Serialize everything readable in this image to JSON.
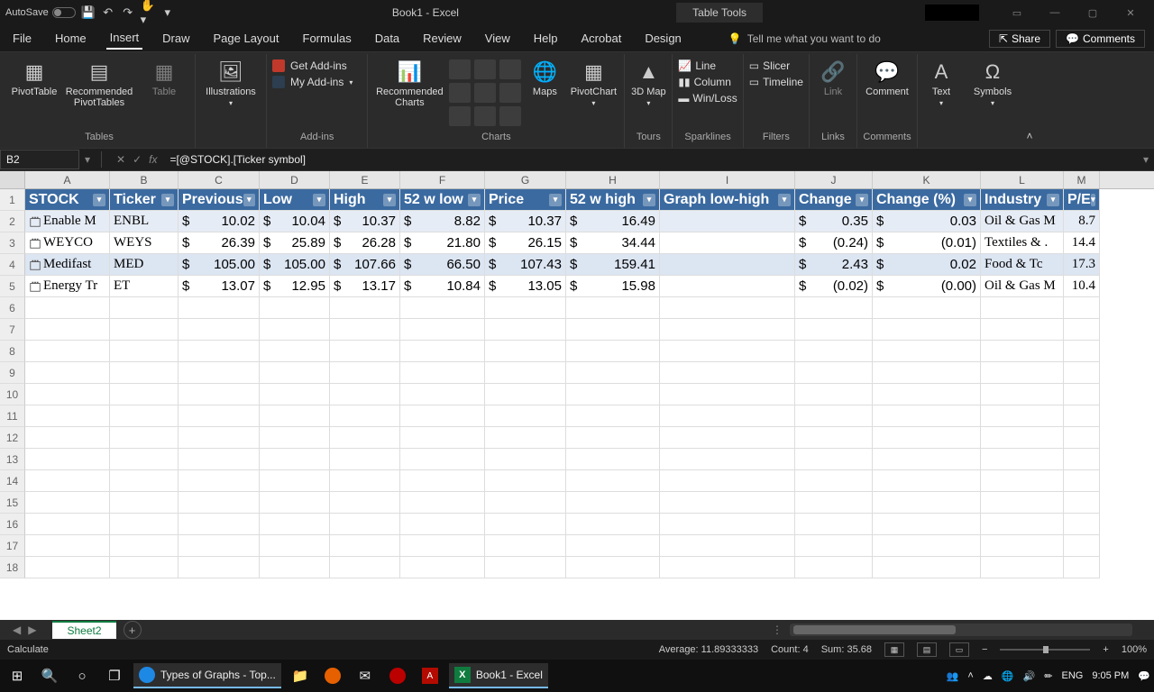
{
  "title": "Book1 - Excel",
  "autosave_label": "AutoSave",
  "table_tools": "Table Tools",
  "tabs": {
    "file": "File",
    "home": "Home",
    "insert": "Insert",
    "draw": "Draw",
    "page_layout": "Page Layout",
    "formulas": "Formulas",
    "data": "Data",
    "review": "Review",
    "view": "View",
    "help": "Help",
    "acrobat": "Acrobat",
    "design": "Design"
  },
  "tellme": "Tell me what you want to do",
  "share": "Share",
  "comments_btn": "Comments",
  "ribbon": {
    "tables": {
      "pivottable": "PivotTable",
      "recommended_pt": "Recommended PivotTables",
      "table": "Table",
      "label": "Tables"
    },
    "illustrations": {
      "btn": "Illustrations"
    },
    "addins": {
      "get": "Get Add-ins",
      "my": "My Add-ins",
      "label": "Add-ins"
    },
    "charts": {
      "recommended": "Recommended Charts",
      "maps": "Maps",
      "pivotchart": "PivotChart",
      "label": "Charts"
    },
    "tours": {
      "map": "3D Map",
      "label": "Tours"
    },
    "sparklines": {
      "line": "Line",
      "col": "Column",
      "winloss": "Win/Loss",
      "label": "Sparklines"
    },
    "filters": {
      "slicer": "Slicer",
      "timeline": "Timeline",
      "label": "Filters"
    },
    "links": {
      "link": "Link",
      "label": "Links"
    },
    "comments": {
      "comment": "Comment",
      "label": "Comments"
    },
    "text": {
      "text": "Text"
    },
    "symbols": {
      "symbols": "Symbols"
    }
  },
  "namebox": "B2",
  "formula": "=[@STOCK].[Ticker symbol]",
  "columns": [
    "A",
    "B",
    "C",
    "D",
    "E",
    "F",
    "G",
    "H",
    "I",
    "J",
    "K",
    "L",
    "M"
  ],
  "headers": {
    "stock": "STOCK",
    "ticker": "Ticker",
    "previous": "Previous",
    "low": "Low",
    "high": "High",
    "w52low": "52 w low",
    "price": "Price",
    "w52high": "52 w high",
    "graph": "Graph low-high",
    "change": "Change",
    "changepct": "Change (%)",
    "industry": "Industry",
    "pe": "P/E"
  },
  "rows": [
    {
      "stock": "Enable M",
      "ticker": "ENBL",
      "previous": "10.02",
      "low": "10.04",
      "high": "10.37",
      "w52low": "8.82",
      "price": "10.37",
      "w52high": "16.49",
      "change": "0.35",
      "changepct": "0.03",
      "industry": "Oil & Gas M",
      "pe": "8.7"
    },
    {
      "stock": "WEYCO",
      "ticker": "WEYS",
      "previous": "26.39",
      "low": "25.89",
      "high": "26.28",
      "w52low": "21.80",
      "price": "26.15",
      "w52high": "34.44",
      "change": "(0.24)",
      "changepct": "(0.01)",
      "industry": "Textiles & .",
      "pe": "14.4"
    },
    {
      "stock": "Medifast",
      "ticker": "MED",
      "previous": "105.00",
      "low": "105.00",
      "high": "107.66",
      "w52low": "66.50",
      "price": "107.43",
      "w52high": "159.41",
      "change": "2.43",
      "changepct": "0.02",
      "industry": "Food & Tc",
      "pe": "17.3"
    },
    {
      "stock": "Energy Tr",
      "ticker": "ET",
      "previous": "13.07",
      "low": "12.95",
      "high": "13.17",
      "w52low": "10.84",
      "price": "13.05",
      "w52high": "15.98",
      "change": "(0.02)",
      "changepct": "(0.00)",
      "industry": "Oil & Gas M",
      "pe": "10.4"
    }
  ],
  "sheet": "Sheet2",
  "status": {
    "calculate": "Calculate",
    "avg_lbl": "Average:",
    "avg": "11.89333333",
    "count_lbl": "Count:",
    "count": "4",
    "sum_lbl": "Sum:",
    "sum": "35.68",
    "zoom": "100%"
  },
  "taskbar": {
    "edge_title": "Types of Graphs - Top...",
    "excel_title": "Book1 - Excel",
    "lang": "ENG",
    "time": "9:05 PM"
  }
}
